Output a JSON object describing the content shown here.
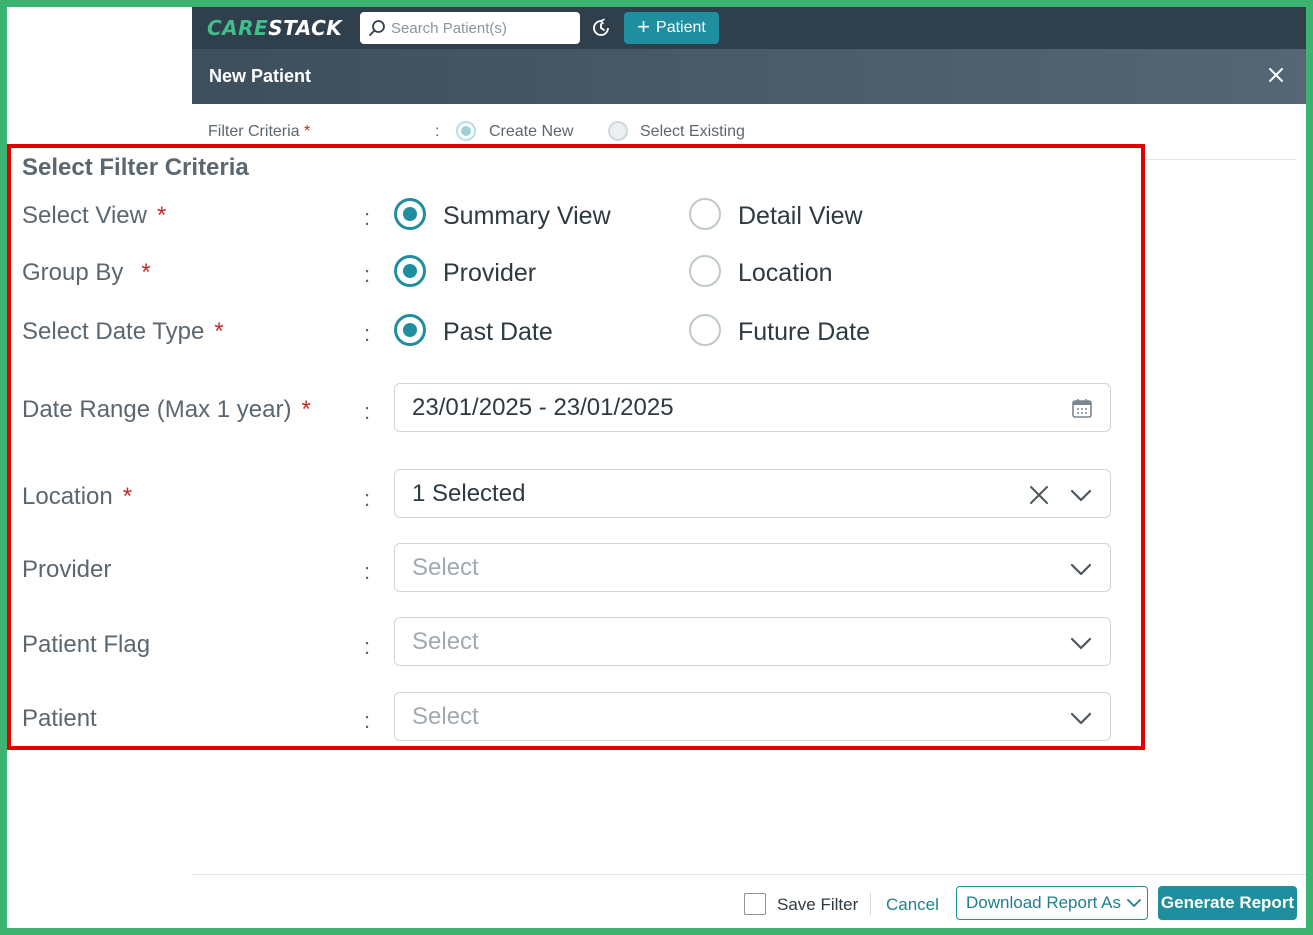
{
  "app": {
    "logo_part1": "CARE",
    "logo_part2": "STACK"
  },
  "topbar": {
    "search_placeholder": "Search Patient(s)",
    "add_patient_label": "Patient"
  },
  "modal": {
    "title": "New Patient"
  },
  "filter_criteria": {
    "label": "Filter Criteria",
    "required_mark": "*",
    "colon": ":",
    "options": [
      {
        "label": "Create New",
        "selected": true
      },
      {
        "label": "Select Existing",
        "selected": false
      }
    ]
  },
  "panel": {
    "title": "Select Filter Criteria",
    "rows": {
      "select_view": {
        "label": "Select View",
        "required": "*",
        "colon": ":",
        "options": [
          "Summary View",
          "Detail View"
        ],
        "selected": "Summary View"
      },
      "group_by": {
        "label": "Group By",
        "required": "*",
        "colon": ":",
        "options": [
          "Provider",
          "Location"
        ],
        "selected": "Provider"
      },
      "date_type": {
        "label": "Select Date Type",
        "required": "*",
        "colon": ":",
        "options": [
          "Past Date",
          "Future Date"
        ],
        "selected": "Past Date"
      },
      "date_range": {
        "label": "Date Range (Max 1 year)",
        "required": "*",
        "colon": ":",
        "value": "23/01/2025 - 23/01/2025"
      },
      "location": {
        "label": "Location",
        "required": "*",
        "colon": ":",
        "value": "1 Selected"
      },
      "provider": {
        "label": "Provider",
        "colon": ":",
        "placeholder": "Select"
      },
      "patient_flag": {
        "label": "Patient Flag",
        "colon": ":",
        "placeholder": "Select"
      },
      "patient": {
        "label": "Patient",
        "colon": ":",
        "placeholder": "Select"
      }
    }
  },
  "footer": {
    "save_filter_label": "Save Filter",
    "cancel_label": "Cancel",
    "download_label": "Download Report As",
    "generate_label": "Generate Report"
  },
  "colors": {
    "accent": "#1f8f9f",
    "header_dark": "#2f3f4c",
    "required": "#c62828",
    "highlight_border": "#e10000",
    "frame": "#3cb371"
  }
}
